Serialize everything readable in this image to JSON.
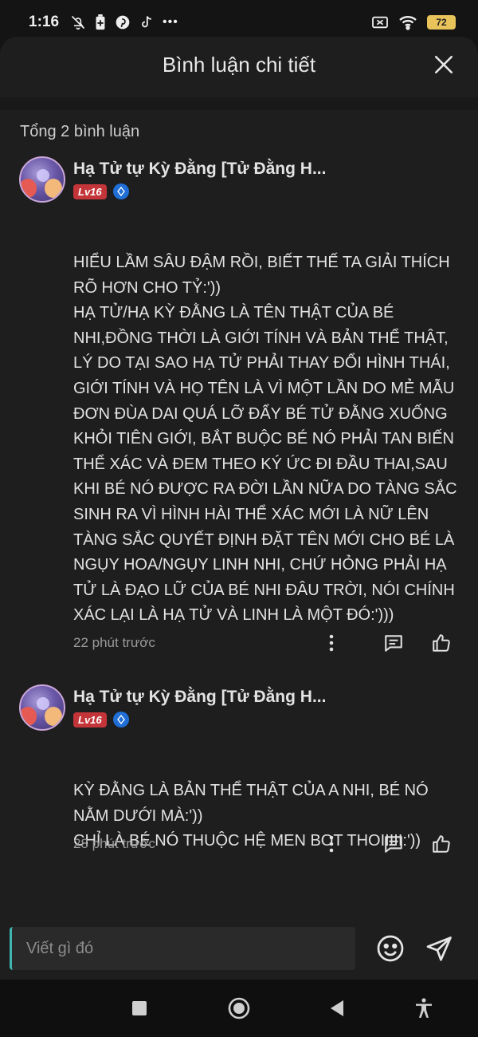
{
  "status_bar": {
    "time": "1:16",
    "dots": "•••",
    "battery": "72"
  },
  "sheet": {
    "title": "Bình luận chi tiết",
    "count_label": "Tổng 2 bình luận"
  },
  "comments": [
    {
      "username": "Hạ Tử tự Kỳ Đằng [Tử Đằng H...",
      "level": "Lv16",
      "text": "HIỂU LẦM SÂU ĐẬM RỒI, BIẾT THẾ TA GIẢI THÍCH RÕ HƠN CHO TỶ:'))\nHẠ TỬ/HẠ KỲ ĐẰNG LÀ TÊN THẬT CỦA BÉ NHI,ĐỒNG THỜI LÀ GIỚI TÍNH VÀ BẢN THỂ THẬT, LÝ DO TẠI SAO HẠ TỬ PHẢI THAY ĐỔI HÌNH THÁI, GIỚI TÍNH VÀ HỌ TÊN LÀ VÌ MỘT LẦN DO MẺ MẪU ĐƠN ĐÙA DAI QUÁ LỠ ĐẨY BÉ TỬ ĐẰNG XUỐNG KHỎI TIÊN GIỚI, BẮT BUỘC BÉ NÓ PHẢI TAN BIẾN THỂ XÁC VÀ ĐEM THEO KÝ ỨC ĐI ĐẦU THAI,SAU KHI BÉ NÓ ĐƯỢC RA ĐỜI LẦN NỮA DO TÀNG SẮC SINH RA VÌ HÌNH HÀI THỂ XÁC MỚI LÀ NỮ LÊN TÀNG SẮC QUYẾT ĐỊNH ĐẶT TÊN MỚI CHO BÉ LÀ NGỤY HOA/NGỤY LINH NHI, CHỨ HỎNG PHẢI HẠ TỬ LÀ ĐẠO LỮ CỦA BÉ NHI ĐÂU TRỜI, NÓI CHÍNH XÁC LẠI LÀ HẠ TỬ VÀ LINH LÀ MỘT ĐÓ:')))",
      "time": "22 phút trước"
    },
    {
      "username": "Hạ Tử tự Kỳ Đằng [Tử Đằng H...",
      "level": "Lv16",
      "text": "KỲ ĐẰNG LÀ BẢN THỂ THẬT CỦA A NHI, BÉ NÓ NẰM DƯỚI MÀ:'))\nCHỈ LÀ BÉ NÓ THUỘC HỆ MEN BOT THOIIIII:'))",
      "time": "28 phút trước"
    }
  ],
  "input": {
    "placeholder": "Viết gì đó"
  },
  "icons": {
    "close": "close-icon",
    "more": "more-vertical-icon",
    "reply": "comment-icon",
    "like": "thumbs-up-icon",
    "emoji": "smiley-icon",
    "send": "send-icon",
    "verified": "verified-badge-icon"
  },
  "colors": {
    "level_badge": "#c4353a",
    "verified": "#1f6fd6",
    "input_caret": "#3fb6b0",
    "battery": "#e8c35a"
  }
}
